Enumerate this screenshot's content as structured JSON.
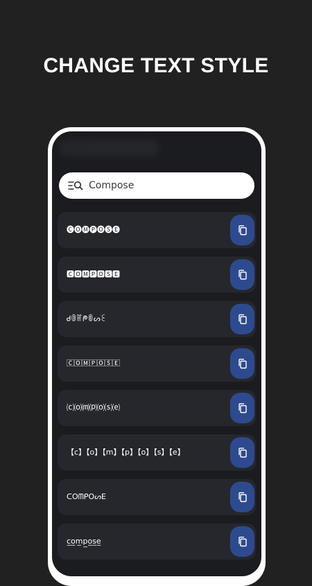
{
  "headline": "CHANGE TEXT STYLE",
  "search": {
    "value": "Compose",
    "icon": "search-list-icon"
  },
  "styles": [
    {
      "text": "🅒🅞🅜🅟🅞🅢🅔"
    },
    {
      "text": "🅲🅾🅼🅿🅾🆂🅴"
    },
    {
      "text": "Ꮷꂦꂵᖘꂦᔕꏂ"
    },
    {
      "text": "🄲🄾🄼🄿🄾🅂🄴"
    },
    {
      "text": "⒞⒪⒨⒫⒪⒮⒠"
    },
    {
      "text": "【c】【o】【m】【p】【o】【s】【e】"
    },
    {
      "text": "ᑕOᗰᑭOᔕE"
    },
    {
      "text": "c̲o̲m̲p̲o̲s̲e̲"
    }
  ],
  "copy_icon": "copy-icon",
  "colors": {
    "background": "#212121",
    "phone_frame": "#ffffff",
    "screen": "#1b1c20",
    "row": "#26272c",
    "copy_button": "#2e4a8e"
  }
}
